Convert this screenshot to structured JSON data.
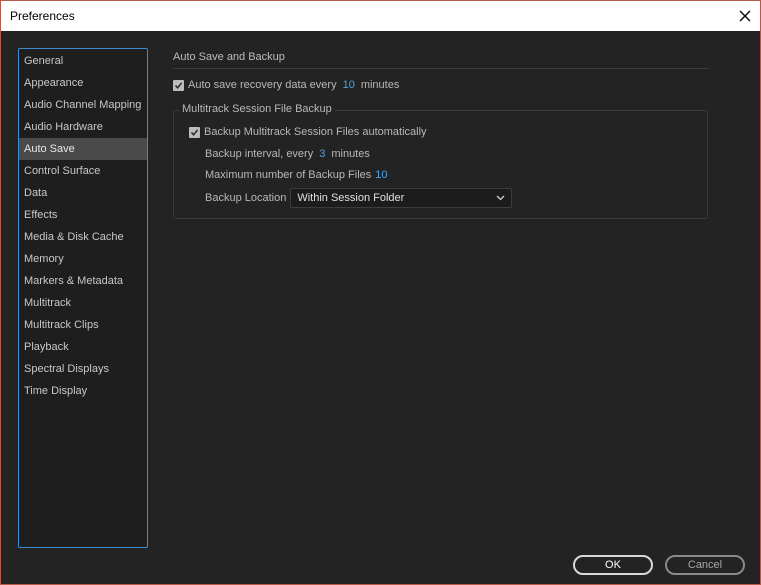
{
  "window": {
    "title": "Preferences"
  },
  "sidebar": {
    "items": [
      {
        "label": "General"
      },
      {
        "label": "Appearance"
      },
      {
        "label": "Audio Channel Mapping"
      },
      {
        "label": "Audio Hardware"
      },
      {
        "label": "Auto Save"
      },
      {
        "label": "Control Surface"
      },
      {
        "label": "Data"
      },
      {
        "label": "Effects"
      },
      {
        "label": "Media & Disk Cache"
      },
      {
        "label": "Memory"
      },
      {
        "label": "Markers & Metadata"
      },
      {
        "label": "Multitrack"
      },
      {
        "label": "Multitrack Clips"
      },
      {
        "label": "Playback"
      },
      {
        "label": "Spectral Displays"
      },
      {
        "label": "Time Display"
      }
    ],
    "selected": "Auto Save"
  },
  "auto_save": {
    "section_title": "Auto Save and Backup",
    "recovery": {
      "label": "Auto save recovery data every",
      "value": "10",
      "unit": "minutes",
      "checked": true
    },
    "multitrack": {
      "group_label": "Multitrack Session File Backup",
      "backup_checkbox": {
        "label": "Backup Multitrack Session Files automatically",
        "checked": true
      },
      "interval": {
        "label": "Backup interval, every",
        "value": "3",
        "unit": "minutes"
      },
      "max_files": {
        "label": "Maximum number of Backup Files",
        "value": "10"
      },
      "location": {
        "label": "Backup Location",
        "selected": "Within Session Folder"
      }
    }
  },
  "footer": {
    "ok_label": "OK",
    "cancel_label": "Cancel"
  },
  "colors": {
    "accent": "#4ea3e6",
    "selection_border": "#3d8cd4",
    "background": "#232323"
  }
}
